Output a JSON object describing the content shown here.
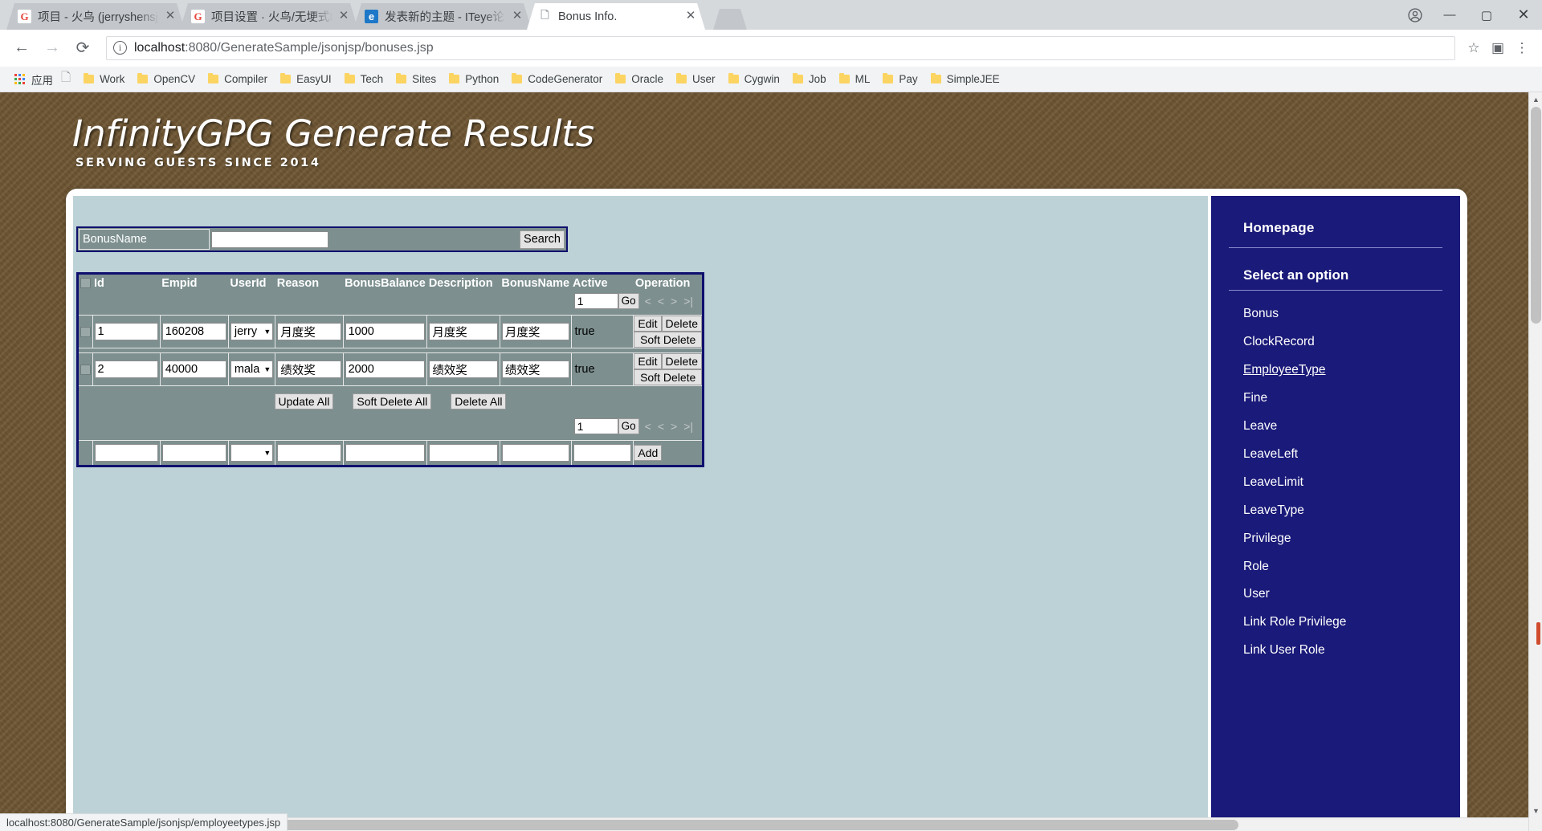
{
  "browser": {
    "tabs": [
      {
        "title": "项目 - 火鸟 (jerryshensj",
        "favicon": "gitlab-icon",
        "active": false
      },
      {
        "title": "项目设置 · 火鸟/无埂式H",
        "favicon": "gitlab-icon",
        "active": false
      },
      {
        "title": "发表新的主题 - ITeye论",
        "favicon": "iteye-icon",
        "active": false
      },
      {
        "title": "Bonus Info.",
        "favicon": "page-icon",
        "active": true
      }
    ],
    "close_label": "✕",
    "window_controls": {
      "minimize": "—",
      "maximize": "▢",
      "close": "✕"
    },
    "nav": {
      "back": "←",
      "forward": "→",
      "reload": "⟳"
    },
    "omnibox": {
      "host": "localhost",
      "path": ":8080/GenerateSample/jsonjsp/bonuses.jsp",
      "star": "☆",
      "extension": "▣",
      "menu": "⋮"
    },
    "bookmarks": {
      "apps_label": "应用",
      "items": [
        "Work",
        "OpenCV",
        "Compiler",
        "EasyUI",
        "Tech",
        "Sites",
        "Python",
        "CodeGenerator",
        "Oracle",
        "User",
        "Cygwin",
        "Job",
        "ML",
        "Pay",
        "SimpleJEE"
      ]
    },
    "status_text": "localhost:8080/GenerateSample/jsonjsp/employeetypes.jsp"
  },
  "page": {
    "title": "InfinityGPG Generate Results",
    "subtitle": "SERVING GUESTS SINCE 2014"
  },
  "search": {
    "field_label": "BonusName",
    "value": "",
    "button_label": "Search"
  },
  "table": {
    "headers": [
      "Id",
      "Empid",
      "UserId",
      "Reason",
      "BonusBalance",
      "Description",
      "BonusName",
      "Active",
      "Operation"
    ],
    "pager_top": {
      "page": "1",
      "go": "Go",
      "first": "<",
      "prev": "<",
      "next": ">",
      "last": ">|"
    },
    "pager_bottom": {
      "page": "1",
      "go": "Go",
      "first": "<",
      "prev": "<",
      "next": ">",
      "last": ">|"
    },
    "rows": [
      {
        "id": "1",
        "empid": "160208",
        "userId": "jerry",
        "reason": "月度奖",
        "bonusBalance": "1000",
        "description": "月度奖",
        "bonusName": "月度奖",
        "active": "true",
        "edit": "Edit",
        "delete": "Delete",
        "soft_delete": "Soft Delete"
      },
      {
        "id": "2",
        "empid": "40000",
        "userId": "mala",
        "reason": "绩效奖",
        "bonusBalance": "2000",
        "description": "绩效奖",
        "bonusName": "绩效奖",
        "active": "true",
        "edit": "Edit",
        "delete": "Delete",
        "soft_delete": "Soft Delete"
      }
    ],
    "bulk": {
      "update_all": "Update All",
      "soft_delete_all": "Soft Delete All",
      "delete_all": "Delete All"
    },
    "add_row": {
      "add_label": "Add"
    }
  },
  "sidebar": {
    "homepage": "Homepage",
    "section_title": "Select an option",
    "items": [
      {
        "label": "Bonus",
        "highlighted": false
      },
      {
        "label": "ClockRecord",
        "highlighted": false
      },
      {
        "label": "EmployeeType",
        "highlighted": true
      },
      {
        "label": "Fine",
        "highlighted": false
      },
      {
        "label": "Leave",
        "highlighted": false
      },
      {
        "label": "LeaveLeft",
        "highlighted": false
      },
      {
        "label": "LeaveLimit",
        "highlighted": false
      },
      {
        "label": "LeaveType",
        "highlighted": false
      },
      {
        "label": "Privilege",
        "highlighted": false
      },
      {
        "label": "Role",
        "highlighted": false
      },
      {
        "label": "User",
        "highlighted": false
      },
      {
        "label": "Link Role Privilege",
        "highlighted": false
      },
      {
        "label": "Link User Role",
        "highlighted": false
      }
    ]
  }
}
